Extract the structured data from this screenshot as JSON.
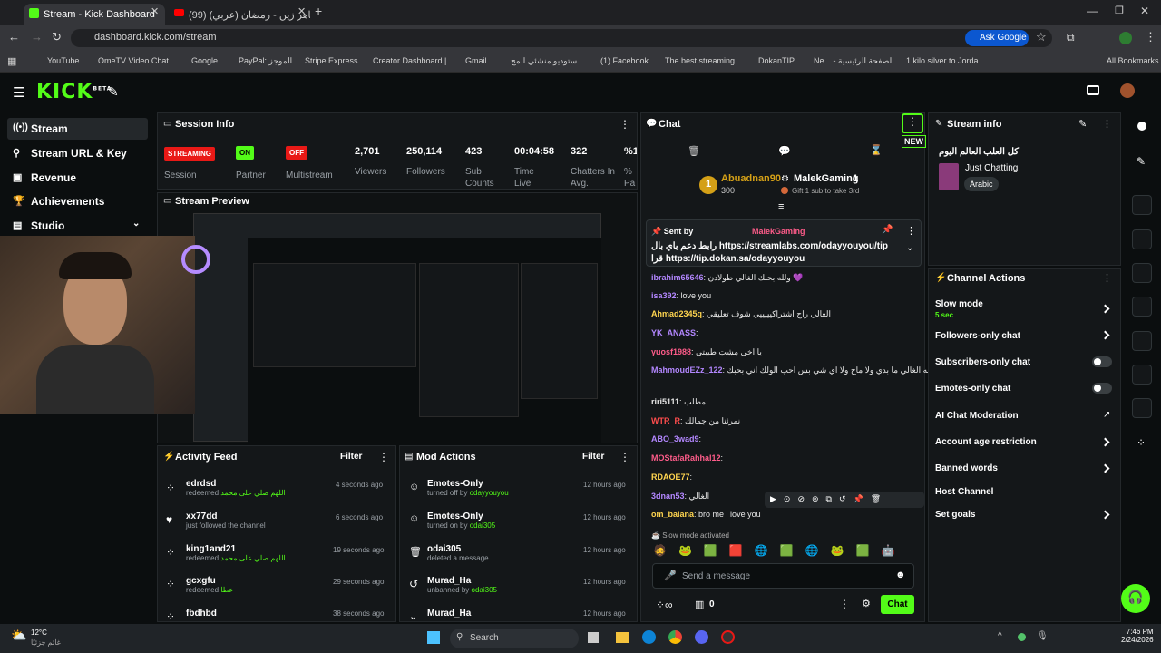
{
  "browser": {
    "tabs": [
      {
        "label": "Stream - Kick Dashboard",
        "active": true
      },
      {
        "label": "(99) ماهر زين - رمضان (عربي) |",
        "active": false
      }
    ],
    "url": "dashboard.kick.com/stream",
    "ask_google": "Ask Google",
    "bookmarks": [
      "YouTube",
      "OmeTV Video Chat...",
      "Google",
      "PayPal: الموجز",
      "Stripe Express",
      "Creator Dashboard |...",
      "Gmail",
      "ستوديو منشئي المح...",
      "(1) Facebook",
      "The best streaming...",
      "DokanTIP",
      "Ne... - الصفحة الرئيسية",
      "1 kilo silver to Jorda..."
    ],
    "all_bookmarks": "All Bookmarks"
  },
  "kick": {
    "logo": "KICK",
    "logo_beta": "BETA"
  },
  "sidebar": {
    "items": [
      {
        "label": "Stream",
        "icon": "broadcast-icon"
      },
      {
        "label": "Stream URL & Key",
        "icon": "link-icon"
      },
      {
        "label": "Revenue",
        "icon": "money-icon"
      },
      {
        "label": "Achievements",
        "icon": "trophy-icon"
      },
      {
        "label": "Studio",
        "icon": "studio-icon"
      }
    ]
  },
  "session": {
    "title": "Session Info",
    "status": [
      {
        "badge": "STREAMING",
        "label": "Session",
        "color": "#e91916"
      },
      {
        "badge": "ON",
        "label": "Partner Income",
        "color": "#53fc18"
      },
      {
        "badge": "OFF",
        "label": "Multistream",
        "color": "#e91916"
      }
    ],
    "stats": [
      {
        "value": "2,701",
        "label": "Viewers"
      },
      {
        "value": "250,114",
        "label": "Followers"
      },
      {
        "value": "423",
        "label": "Sub Counts"
      },
      {
        "value": "00:04:58",
        "label": "Time Live"
      },
      {
        "value": "322",
        "label": "Chatters In Avg."
      },
      {
        "value": "%1",
        "label": "% Pa"
      }
    ]
  },
  "preview": {
    "title": "Stream Preview"
  },
  "activity": {
    "title": "Activity Feed",
    "filter": "Filter",
    "rows": [
      {
        "name": "edrdsd",
        "sub": "redeemed",
        "extra": "اللهم صلي على محمد",
        "time": "4 seconds ago"
      },
      {
        "name": "xx77dd",
        "sub": "just followed the channel",
        "extra": "",
        "time": "6 seconds ago"
      },
      {
        "name": "king1and21",
        "sub": "redeemed",
        "extra": "اللهم صلي على محمد",
        "time": "19 seconds ago"
      },
      {
        "name": "gcxgfu",
        "sub": "redeemed",
        "extra": "عطا",
        "time": "29 seconds ago"
      },
      {
        "name": "fbdhbd",
        "sub": "",
        "extra": "",
        "time": "38 seconds ago"
      }
    ]
  },
  "mod": {
    "title": "Mod Actions",
    "filter": "Filter",
    "rows": [
      {
        "name": "Emotes-Only",
        "sub": "turned off by",
        "by": "odayyouyou",
        "time": "12 hours ago"
      },
      {
        "name": "Emotes-Only",
        "sub": "turned on by",
        "by": "odai305",
        "time": "12 hours ago"
      },
      {
        "name": "odai305",
        "sub": "deleted a message",
        "by": "",
        "time": "12 hours ago"
      },
      {
        "name": "Murad_Ha",
        "sub": "unbanned by",
        "by": "odai305",
        "time": "12 hours ago"
      },
      {
        "name": "Murad_Ha",
        "sub": "",
        "by": "",
        "time": "12 hours ago"
      }
    ]
  },
  "chat": {
    "title": "Chat",
    "new_badge": "NEW",
    "top_gifter": {
      "name": "Abuadnan90",
      "amount": "300"
    },
    "gift": {
      "name": "MalekGaming",
      "count": "1",
      "note": "Gift 1 sub to take 3rd"
    },
    "pinned": {
      "sent_by": "Sent by",
      "author": "MalekGaming",
      "text": "رابط دعم باي بال https://streamlabs.com/odayyouyou/tip",
      "text2": "قرا https://tip.dokan.sa/odayyouyou"
    },
    "messages": [
      {
        "user": "ibrahim65646",
        "color": "#b387ff",
        "text": "ولله بحبك الغالي طولادن 💜"
      },
      {
        "user": "isa392",
        "color": "#b387ff",
        "text": "love you"
      },
      {
        "user": "Ahmad2345q",
        "color": "#ffd54f",
        "text": "الغالي راح اشتراكيييييي شوف تعليقي"
      },
      {
        "user": "YK_ANASS",
        "color": "#b387ff",
        "text": ""
      },
      {
        "user": "yuosf1988",
        "color": "#ff5c8a",
        "text": "يا اخي مشت طيبتي"
      },
      {
        "user": "MahmoudEZz_122",
        "color": "#b387ff",
        "text": "والله الغالي ما بدي ولا ماج ولا اي شي بس احب الولك اني بحبك"
      },
      {
        "user": "riri5111",
        "color": "#e8e8e8",
        "text": "مظلب"
      },
      {
        "user": "WTR_R",
        "color": "#ff4d4d",
        "text": "نمرئنا من جمالك"
      },
      {
        "user": "ABO_3wad9",
        "color": "#b387ff",
        "text": ""
      },
      {
        "user": "MOStafaRahhal12",
        "color": "#ff5c8a",
        "text": ""
      },
      {
        "user": "RDAOE77",
        "color": "#ffd54f",
        "text": ""
      },
      {
        "user": "3dnan53",
        "color": "#b387ff",
        "text": "الغالي"
      },
      {
        "user": "om_balana",
        "color": "#ffd54f",
        "text": "bro me i love you"
      }
    ],
    "slow_mode_note": "Slow mode activated",
    "input_placeholder": "Send a message",
    "counter": "0",
    "send": "Chat"
  },
  "stream_info": {
    "title": "Stream info",
    "stream_title": "كل العلب العالم اليوم",
    "category": "Just Chatting",
    "language": "Arabic"
  },
  "channel_actions": {
    "title": "Channel Actions",
    "items": [
      {
        "label": "Slow mode",
        "sub": "5 sec",
        "control": "chevron"
      },
      {
        "label": "Followers-only chat",
        "sub": "",
        "control": "chevron"
      },
      {
        "label": "Subscribers-only chat",
        "sub": "",
        "control": "toggle"
      },
      {
        "label": "Emotes-only chat",
        "sub": "",
        "control": "toggle"
      },
      {
        "label": "AI Chat Moderation",
        "sub": "",
        "control": "external"
      },
      {
        "label": "Account age restriction",
        "sub": "",
        "control": "chevron"
      },
      {
        "label": "Banned words",
        "sub": "",
        "control": "chevron"
      },
      {
        "label": "Host Channel",
        "sub": "",
        "control": "none"
      },
      {
        "label": "Set goals",
        "sub": "",
        "control": "chevron"
      }
    ]
  },
  "taskbar": {
    "weather_temp": "12°C",
    "weather_desc": "غائم جزئيًا",
    "search": "Search",
    "time": "7:46 PM",
    "date": "2/24/2026"
  },
  "colors": {
    "kick_green": "#53fc18",
    "bg": "#0b0e0f",
    "panel": "#141719",
    "red": "#e91916"
  }
}
